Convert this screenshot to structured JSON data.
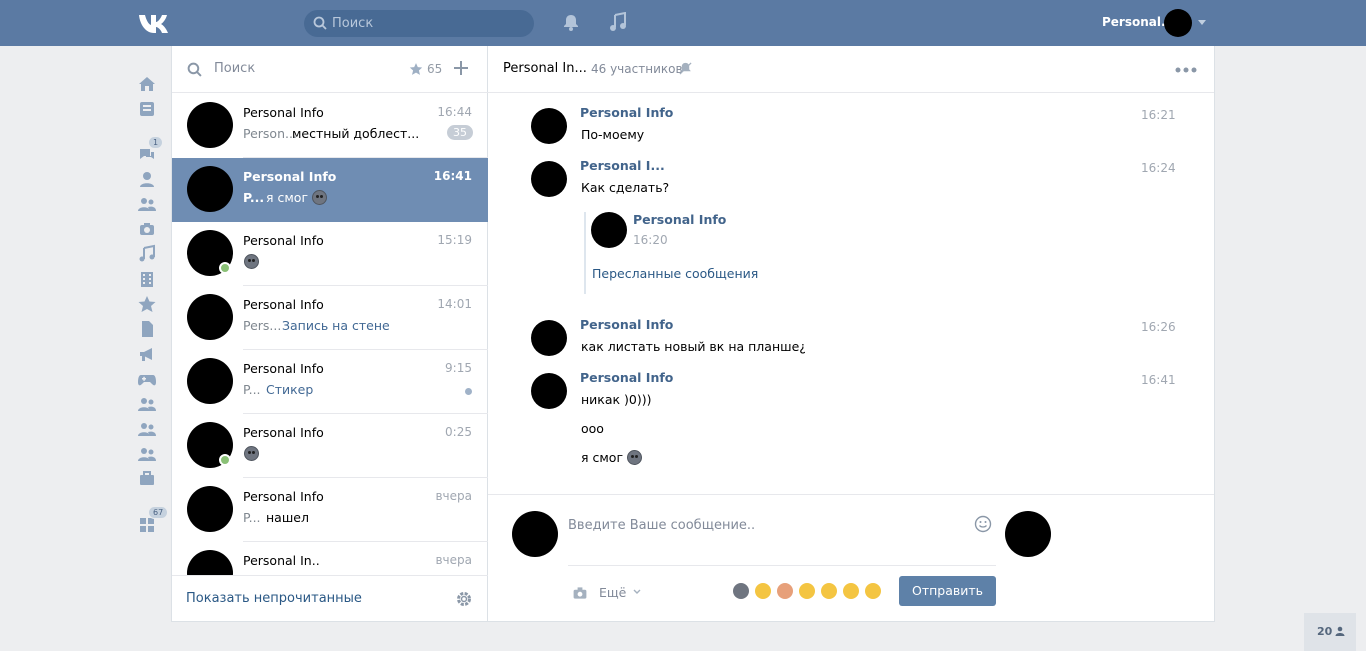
{
  "header": {
    "search_placeholder": "Поиск",
    "user_name": "Personal..."
  },
  "nav": {
    "messages_badge": "1",
    "apps_badge": "67"
  },
  "dialogs": {
    "search_placeholder": "Поиск",
    "favorites_count": "65",
    "footer_link": "Показать непрочитанные",
    "items": [
      {
        "name": "Personal Info",
        "time": "16:44",
        "sender": "Person...",
        "text": "местный доблест...",
        "unread": "35"
      },
      {
        "name": "Personal Info",
        "time": "16:41",
        "sender": "P...",
        "text": "я смог"
      },
      {
        "name": "Personal Info",
        "time": "15:19",
        "sender": "",
        "text": ""
      },
      {
        "name": "Personal Info",
        "time": "14:01",
        "sender": "Pers...",
        "text": "Запись на стене"
      },
      {
        "name": "Personal Info",
        "time": "9:15",
        "sender": "P...",
        "text": "Стикер"
      },
      {
        "name": "Personal Info",
        "time": "0:25",
        "sender": "",
        "text": ""
      },
      {
        "name": "Personal Info",
        "time": "вчера",
        "sender": "P...",
        "text": "нашел"
      },
      {
        "name": "Personal In..",
        "time": "вчера",
        "sender": "",
        "text": ""
      }
    ]
  },
  "chat": {
    "title": "Personal In...",
    "members": "46 участников",
    "messages": [
      {
        "name": "Personal Info",
        "time": "16:21",
        "text": "По-моему"
      },
      {
        "name": "Personal I...",
        "time": "16:24",
        "text": "Как сделать?"
      },
      {
        "name": "Personal Info",
        "time": "16:26",
        "text": "как листать новый вк на планше¿"
      },
      {
        "name": "Personal Info",
        "time": "16:41",
        "text": "никак )0)))"
      }
    ],
    "forwarded": {
      "name": "Personal Info",
      "time": "16:20",
      "link": "Пересланные сообщения"
    },
    "extra_lines": [
      "ооо",
      "я смог"
    ],
    "composer": {
      "placeholder": "Введите Ваше сообщение..",
      "more": "Ещё",
      "send": "Отправить"
    }
  },
  "online_count": "20",
  "colors": {
    "header": "#5b7aa3",
    "accent": "#5e81a8",
    "link": "#2a5885",
    "active_row": "#6f8db3"
  }
}
